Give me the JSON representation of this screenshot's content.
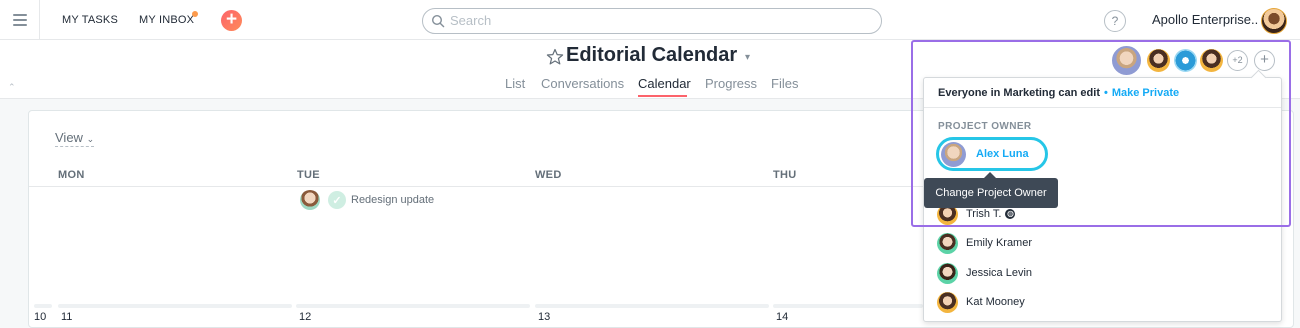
{
  "topbar": {
    "my_tasks": "MY TASKS",
    "my_inbox": "MY INBOX",
    "search_placeholder": "Search",
    "help": "?",
    "org_name": "Apollo Enterprise.."
  },
  "project": {
    "title": "Editorial Calendar",
    "tabs": [
      "List",
      "Conversations",
      "Calendar",
      "Progress",
      "Files"
    ],
    "active_tab": "Calendar"
  },
  "calendar": {
    "view_label": "View",
    "days": [
      "MON",
      "TUE",
      "WED",
      "THU"
    ],
    "task": {
      "name": "Redesign update"
    },
    "dates": [
      "10",
      "11",
      "12",
      "13",
      "14"
    ]
  },
  "members": {
    "extra_count": "+2",
    "add_label": "+",
    "permission_text": "Everyone in Marketing can edit",
    "separator": "•",
    "make_private": "Make Private",
    "owner_heading": "PROJECT OWNER",
    "owner_name": "Alex Luna",
    "tooltip": "Change Project Owner",
    "list": [
      {
        "name": "Trish T."
      },
      {
        "name": "Emily Kramer"
      },
      {
        "name": "Jessica Levin"
      },
      {
        "name": "Kat Mooney"
      }
    ]
  },
  "colors": {
    "accent": "#14aaf5",
    "highlight": "#9a6ee7",
    "tab_underline": "#fc636b",
    "add_button": "#fc636b"
  }
}
